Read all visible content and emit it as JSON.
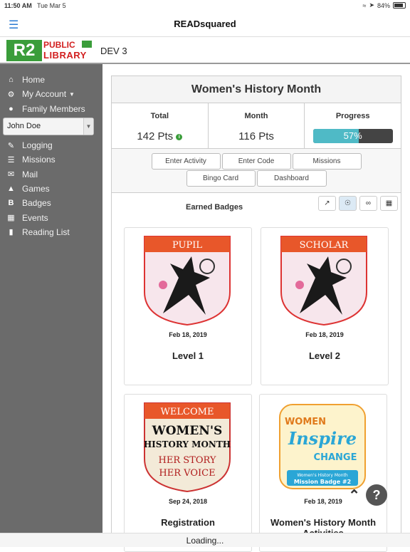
{
  "status_bar": {
    "time": "11:50 AM",
    "date": "Tue Mar 5",
    "battery": "84%",
    "battery_level": 0.84
  },
  "top_bar": {
    "title": "READsquared"
  },
  "brand": {
    "logo_mark": "R2",
    "logo_line1": "PUBLIC",
    "logo_line2": "LIBRARY",
    "env_label": "DEV 3"
  },
  "sidebar": {
    "items": [
      {
        "label": "Home",
        "icon": "home-icon"
      },
      {
        "label": "My Account",
        "icon": "gear-icon"
      },
      {
        "label": "Family Members",
        "icon": "user-icon"
      }
    ],
    "profile_select": "John Doe",
    "items2": [
      {
        "label": "Logging",
        "icon": "pencil-icon"
      },
      {
        "label": "Missions",
        "icon": "list-icon"
      },
      {
        "label": "Mail",
        "icon": "mail-icon"
      },
      {
        "label": "Games",
        "icon": "graduation-icon"
      },
      {
        "label": "Badges",
        "icon": "badge-icon"
      },
      {
        "label": "Events",
        "icon": "calendar-icon"
      },
      {
        "label": "Reading List",
        "icon": "book-icon"
      }
    ]
  },
  "program": {
    "title": "Women's History Month",
    "total_label": "Total",
    "total_value": "142 Pts",
    "month_label": "Month",
    "month_value": "116 Pts",
    "progress_label": "Progress",
    "progress_value": "57%",
    "progress_fraction": 0.57
  },
  "actions": [
    "Enter Activity",
    "Enter Code",
    "Missions",
    "Bingo Card",
    "Dashboard"
  ],
  "badges": {
    "heading": "Earned Badges",
    "views": [
      "chart-icon",
      "trophy-icon",
      "link-icon",
      "map-icon"
    ],
    "cards": [
      {
        "banner": "PUPIL",
        "date": "Feb 18, 2019",
        "name": "Level 1"
      },
      {
        "banner": "SCHOLAR",
        "date": "Feb 18, 2019",
        "name": "Level 2"
      },
      {
        "banner": "WELCOME",
        "art1": "WOMEN'S",
        "art2": "HISTORY MONTH",
        "art3": "HER STORY",
        "art4": "HER VOICE",
        "date": "Sep 24, 2018",
        "name": "Registration"
      },
      {
        "art1": "WOMEN",
        "art2": "Inspire",
        "art3": "CHANGE",
        "art4": "Women's History Month",
        "art5": "Mission Badge #2",
        "date": "Feb 18, 2019",
        "name": "Women's History Month Activities"
      }
    ]
  },
  "help": "?",
  "footer": {
    "status": "Loading..."
  },
  "colors": {
    "accent": "#4fbac6",
    "sidebar": "#6b6b6b",
    "banner": "#e8572a",
    "brand_green": "#3a9d3a",
    "brand_red": "#d21f1f"
  }
}
